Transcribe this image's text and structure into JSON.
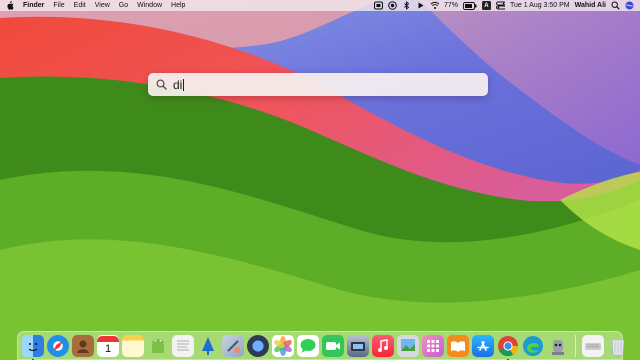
{
  "menubar": {
    "apple_icon": "apple-icon",
    "items": [
      "Finder",
      "File",
      "Edit",
      "View",
      "Go",
      "Window",
      "Help"
    ],
    "status_icons": [
      "menu-app-icon",
      "focus-icon",
      "bluetooth-icon",
      "play-icon",
      "wifi-icon"
    ],
    "battery": "77%",
    "input_source": "A",
    "datetime": "Tue 1 Aug  3:50 PM",
    "user": "Wahid Ali",
    "extra_icons": [
      "search-icon",
      "control-center-icon"
    ]
  },
  "spotlight": {
    "icon": "search-icon",
    "query": "di"
  },
  "dock": {
    "apps": [
      {
        "name": "finder",
        "color": "#2e7de0",
        "running": true
      },
      {
        "name": "safari",
        "color": "#1f8fe8",
        "running": false
      },
      {
        "name": "contacts",
        "color": "#a86c3f",
        "running": false
      },
      {
        "name": "calendar",
        "color": "#ffffff",
        "running": false
      },
      {
        "name": "notes",
        "color": "#fff6c6",
        "running": false
      },
      {
        "name": "android-studio",
        "color": "#7cc043",
        "running": false
      },
      {
        "name": "textedit",
        "color": "#f2f2f2",
        "running": false
      },
      {
        "name": "sourcetree",
        "color": "#1d6fd6",
        "running": false
      },
      {
        "name": "instruments",
        "color": "#8fa9bd",
        "running": false
      },
      {
        "name": "quicktime",
        "color": "#2d3b55",
        "running": false
      },
      {
        "name": "photos",
        "color": "#f5a33a",
        "running": false
      },
      {
        "name": "messages",
        "color": "#2fcf56",
        "running": false
      },
      {
        "name": "facetime",
        "color": "#35c65a",
        "running": false
      },
      {
        "name": "image-capture",
        "color": "#5a6a85",
        "running": false
      },
      {
        "name": "music",
        "color": "#fb3b5a",
        "running": false
      },
      {
        "name": "preview",
        "color": "#d7d9de",
        "running": false
      },
      {
        "name": "launchpad",
        "color": "#e96fa4",
        "running": false
      },
      {
        "name": "books",
        "color": "#f58a1f",
        "running": false
      },
      {
        "name": "app-store",
        "color": "#1d8ff0",
        "running": false
      },
      {
        "name": "chrome",
        "color": "#e8e8e8",
        "running": true
      },
      {
        "name": "edge",
        "color": "#1b9ad6",
        "running": false
      },
      {
        "name": "automator",
        "color": "#9aa0a8",
        "running": false
      },
      {
        "name": "keyboard",
        "color": "#f3f3f3",
        "running": false
      },
      {
        "name": "trash",
        "color": "#dfe4e8",
        "running": false
      }
    ]
  }
}
